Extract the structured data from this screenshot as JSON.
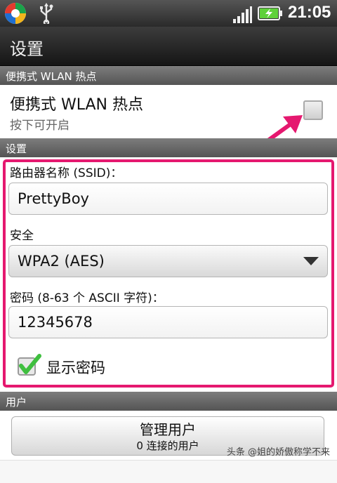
{
  "status_bar": {
    "time": "21:05"
  },
  "title_bar": {
    "title": "设置"
  },
  "hotspot_section": {
    "header": "便携式 WLAN 热点",
    "item_title": "便携式 WLAN 热点",
    "item_subtitle": "按下可开启",
    "checked": false
  },
  "settings_section": {
    "header": "设置",
    "ssid_label": "路由器名称 (SSID)：",
    "ssid_value": "PrettyBoy",
    "security_label": "安全",
    "security_value": "WPA2 (AES)",
    "password_label": "密码 (8-63 个 ASCII 字符)：",
    "password_value": "12345678",
    "show_password_label": "显示密码",
    "show_password_checked": true
  },
  "users_section": {
    "header": "用户",
    "manage_title": "管理用户",
    "manage_subtitle": "0 连接的用户"
  },
  "watermark": "头条 @姐的娇傲称学不来",
  "colors": {
    "highlight": "#e5186f",
    "check": "#3fbf3f"
  }
}
